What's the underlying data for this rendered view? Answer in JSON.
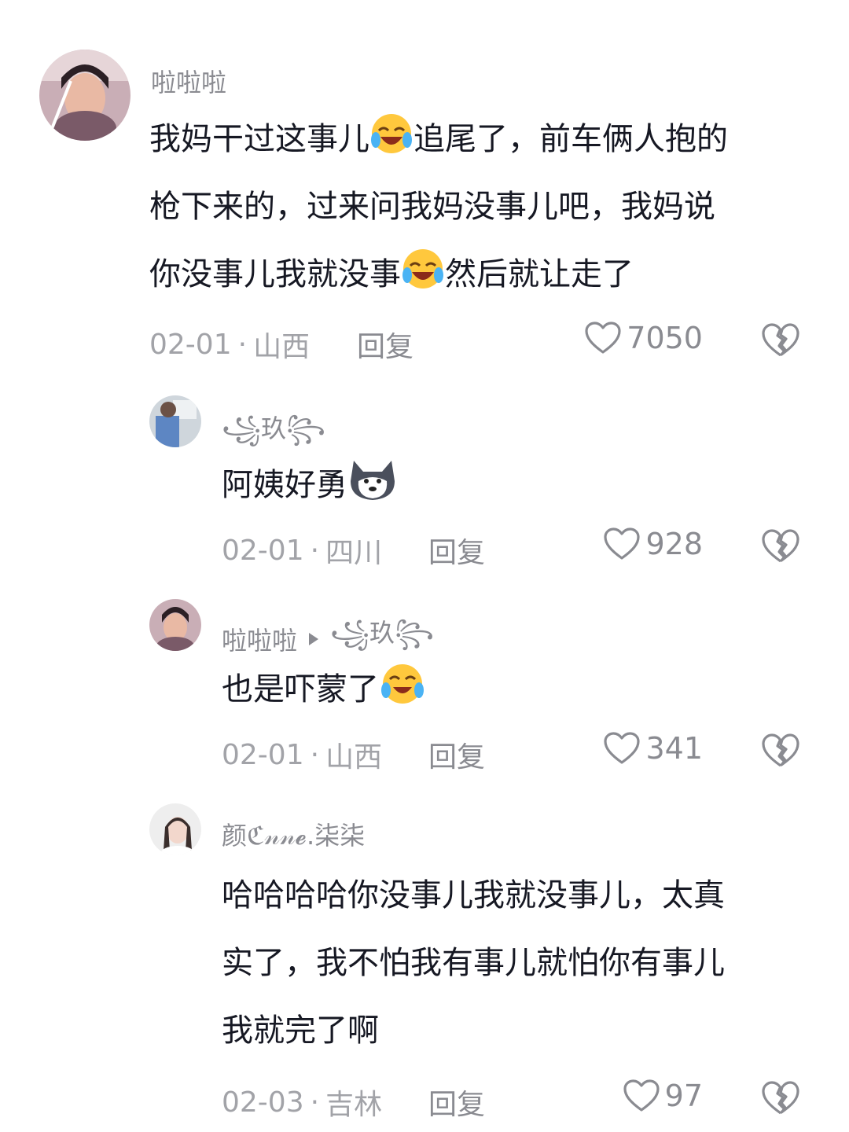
{
  "comments": [
    {
      "username": "啦啦啦",
      "lines": [
        "我妈干过这事儿",
        "追尾了，前车俩人抱的",
        "枪下来的，过来问我妈没事儿吧，我妈说",
        "你没事儿我就没事",
        "然后就让走了"
      ],
      "date": "02-01",
      "location": "山西",
      "reply_label": "回复",
      "likes": "7050",
      "emoji": "joy-icon"
    },
    {
      "username": "꧁玖꧂",
      "text": "阿姨好勇",
      "emoji": "husky-dog-icon",
      "date": "02-01",
      "location": "四川",
      "reply_label": "回复",
      "likes": "928"
    },
    {
      "username": "啦啦啦",
      "reply_to": "꧁玖꧂",
      "text": "也是吓蒙了",
      "emoji": "joy-icon",
      "date": "02-01",
      "location": "山西",
      "reply_label": "回复",
      "likes": "341"
    },
    {
      "username": "颜ℭ𝓃𝓃𝓮.柒柒",
      "lines": [
        "哈哈哈哈你没事儿我就没事儿，太真",
        "实了，我不怕我有事儿就怕你有事儿",
        "我就完了啊"
      ],
      "date": "02-03",
      "location": "吉林",
      "reply_label": "回复",
      "likes": "97"
    }
  ],
  "separator": "·",
  "colors": {
    "text": "#161823",
    "meta": "#a2a3a8",
    "secondary": "#8a8b91"
  }
}
